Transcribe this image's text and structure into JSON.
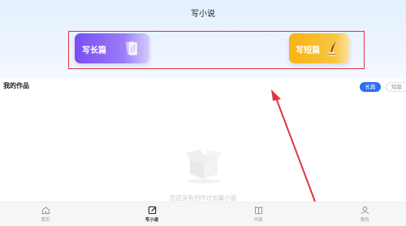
{
  "header": {
    "title": "写小说"
  },
  "cards": {
    "long": {
      "label": "写长篇",
      "icon": "book-pages-icon"
    },
    "short": {
      "label": "写短篇",
      "icon": "quill-pen-icon"
    }
  },
  "works": {
    "title": "我的作品",
    "tabs": [
      {
        "label": "长篇",
        "active": true
      },
      {
        "label": "短篇",
        "active": false
      }
    ],
    "empty_text": "您还没有创作过长篇小说"
  },
  "tabbar": {
    "items": [
      {
        "label": "首页",
        "icon": "home-icon",
        "active": false
      },
      {
        "label": "写小说",
        "icon": "edit-icon",
        "active": true
      },
      {
        "label": "书架",
        "icon": "book-icon",
        "active": false
      },
      {
        "label": "我的",
        "icon": "user-icon",
        "active": false
      }
    ]
  },
  "colors": {
    "accent": "#2e6df6",
    "long_card": "#7a4df2",
    "short_card": "#f8b314",
    "annotation": "#e0353d"
  }
}
